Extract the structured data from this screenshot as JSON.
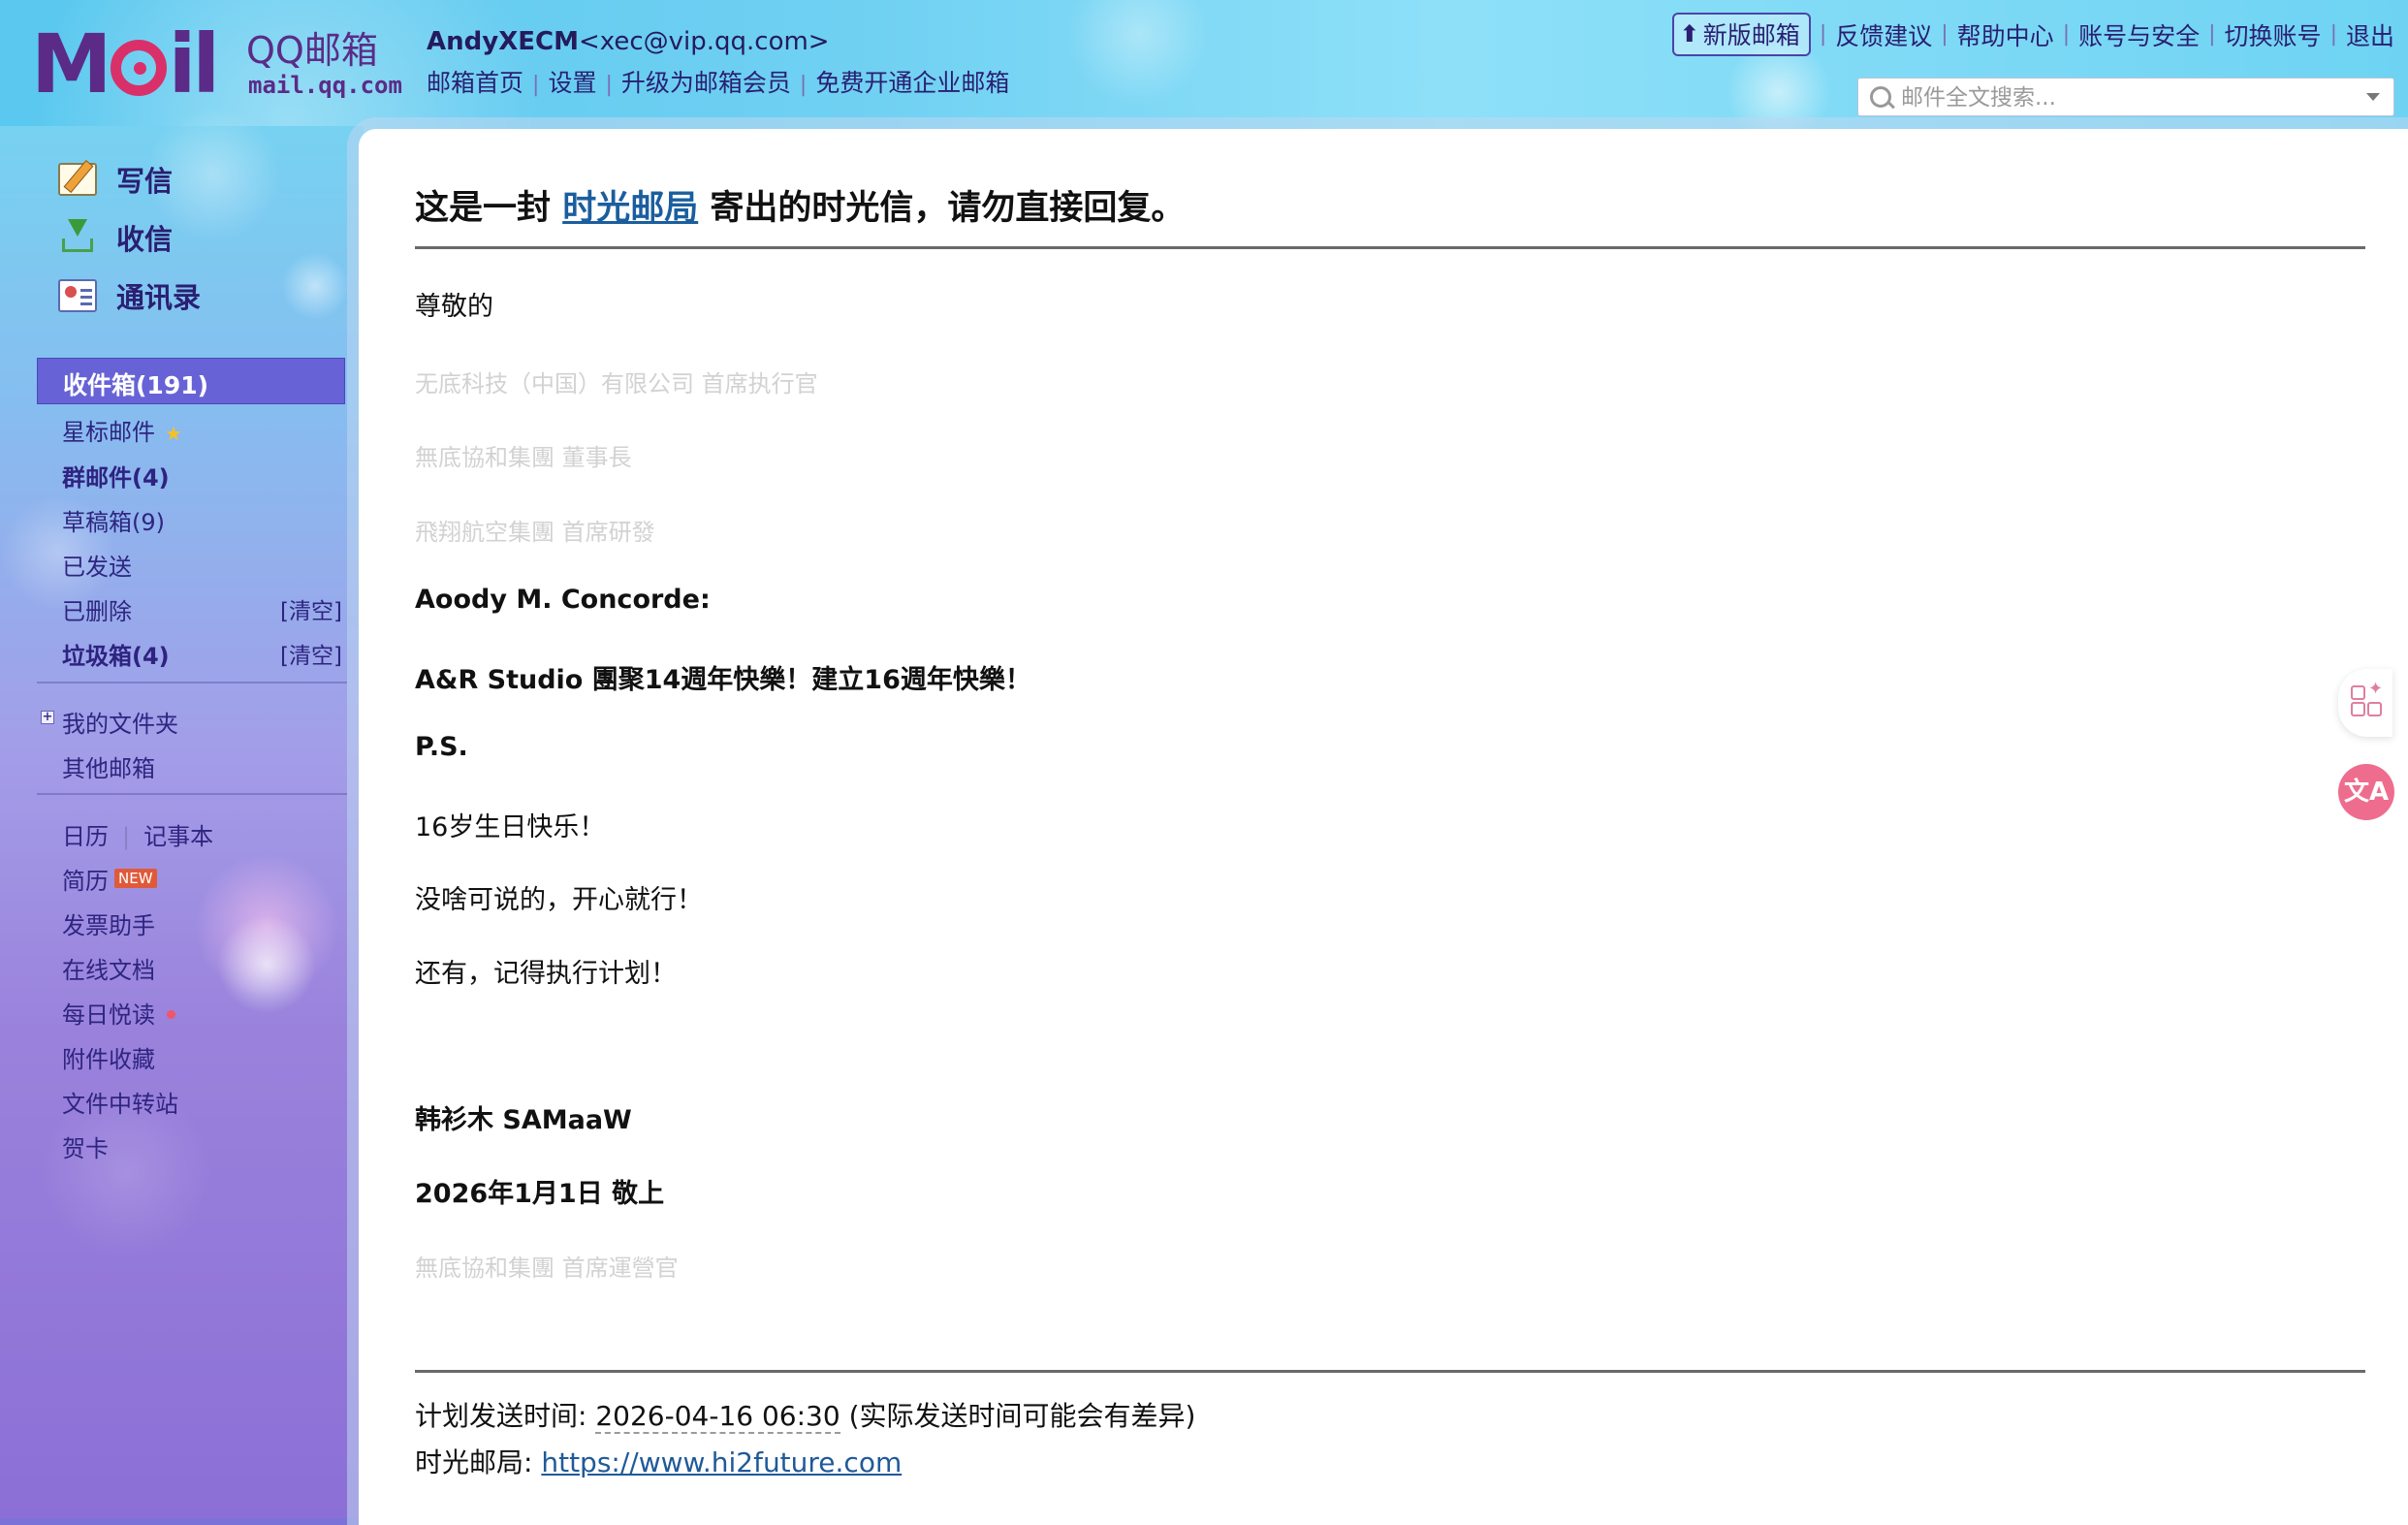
{
  "header": {
    "logo_mark": "MOil",
    "logo_cn": "QQ邮箱",
    "logo_url": "mail.qq.com",
    "user_name": "AndyXECM",
    "user_email": "<xec@vip.qq.com>",
    "links": [
      "邮箱首页",
      "设置",
      "升级为邮箱会员",
      "免费开通企业邮箱"
    ],
    "top_right": {
      "new_version": "新版邮箱",
      "items": [
        "反馈建议",
        "帮助中心",
        "账号与安全",
        "切换账号",
        "退出"
      ]
    },
    "search_placeholder": "邮件全文搜索..."
  },
  "sidebar": {
    "actions": [
      {
        "label": "写信",
        "icon": "compose-icon"
      },
      {
        "label": "收信",
        "icon": "receive-icon"
      },
      {
        "label": "通讯录",
        "icon": "contacts-icon"
      }
    ],
    "inbox": "收件箱(191)",
    "folders": {
      "starred": "星标邮件",
      "group": "群邮件(4)",
      "drafts": "草稿箱(9)",
      "sent": "已发送",
      "deleted": "已删除",
      "spam": "垃圾箱(4)",
      "clear": "[清空]",
      "my_folders": "我的文件夹",
      "other_mailboxes": "其他邮箱"
    },
    "tools": {
      "calendar": "日历",
      "notepad": "记事本",
      "resume": "简历",
      "new_badge": "NEW",
      "invoice": "发票助手",
      "docs": "在线文档",
      "daily_read": "每日悦读",
      "attachments": "附件收藏",
      "file_transfer": "文件中转站",
      "greeting_card": "贺卡"
    }
  },
  "mail": {
    "title_prefix": "这是一封",
    "title_link": "时光邮局",
    "title_suffix": "寄出的时光信，请勿直接回复。",
    "greeting": "尊敬的",
    "faint_line_1": "无底科技（中国）有限公司 首席执行官",
    "faint_line_2": "無底協和集團 董事長",
    "faint_line_3": "飛翔航空集團 首席研發",
    "recipient": "Aoody M. Concorde:",
    "headline": "A&R Studio 團聚14週年快樂！建立16週年快樂！",
    "ps": "P.S.",
    "body_1": "16岁生日快乐！",
    "body_2": "没啥可说的，开心就行！",
    "body_3": "还有，记得执行计划！",
    "signature_name": "韩衫木 SAMaaW",
    "signature_date": "2026年1月1日 敬上",
    "faint_line_4": "無底協和集團 首席運營官",
    "scheduled_label": "计划发送时间: ",
    "scheduled_time": "2026-04-16 06:30",
    "scheduled_note": " (实际发送时间可能会有差异)",
    "post_office_label": "时光邮局: ",
    "post_office_url": "https://www.hi2future.com"
  },
  "floating": {
    "translate_glyph": "文A"
  }
}
